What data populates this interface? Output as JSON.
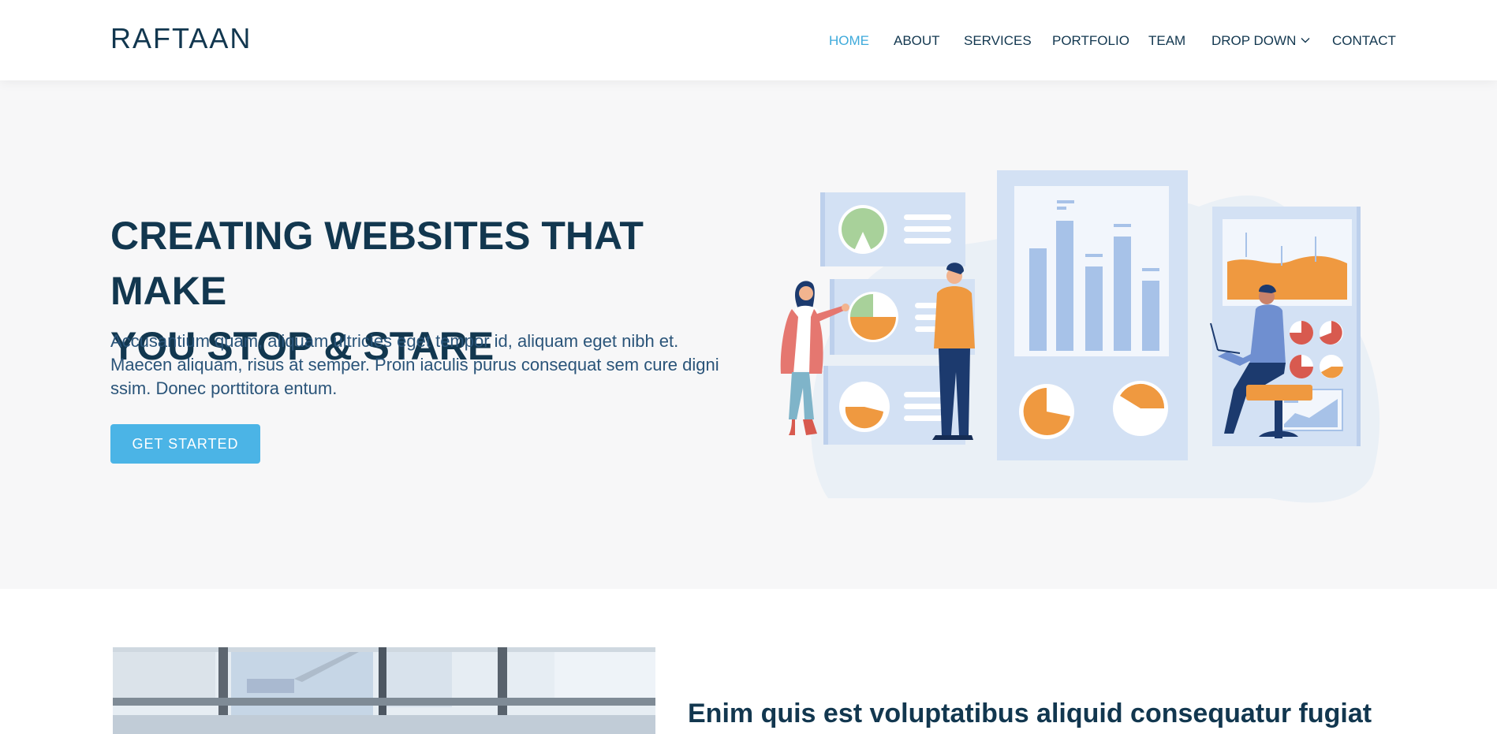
{
  "header": {
    "logo": "RAFTAAN",
    "nav": [
      {
        "label": "HOME",
        "active": true
      },
      {
        "label": "ABOUT",
        "active": false
      },
      {
        "label": "SERVICES",
        "active": false
      },
      {
        "label": "PORTFOLIO",
        "active": false
      },
      {
        "label": "TEAM",
        "active": false
      },
      {
        "label": "DROP DOWN",
        "active": false,
        "has_dropdown": true
      },
      {
        "label": "CONTACT",
        "active": false
      }
    ]
  },
  "hero": {
    "title_line1": "CREATING WEBSITES THAT MAKE",
    "title_line2": "YOU STOP & STARE",
    "description": "Accusantium quam, aliquam ultricies eget tempor id, aliquam eget nibh et. Maecen aliquam, risus at semper. Proin iaculis purus consequat sem cure digni ssim. Donec porttitora entum.",
    "cta_label": "GET STARTED",
    "illustration": "analytics-team-illustration"
  },
  "about": {
    "image": "office-building-photo",
    "title": "Enim quis est voluptatibus aliquid consequatur fugiat"
  },
  "colors": {
    "primary": "#12374f",
    "accent": "#3eaadb",
    "button": "#4bb4e6",
    "hero_bg": "#f7f7f8",
    "orange": "#ef9940",
    "light_blue": "#a7c2e8"
  }
}
